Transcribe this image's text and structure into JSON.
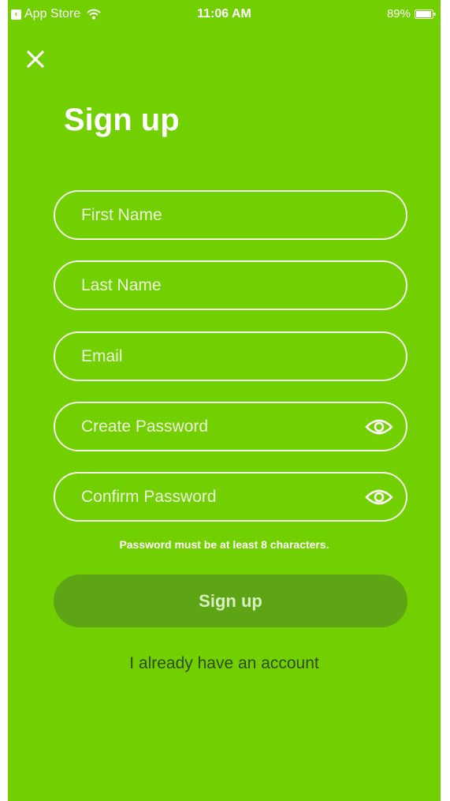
{
  "status_bar": {
    "back_app": "App Store",
    "time": "11:06 AM",
    "battery": "89%"
  },
  "title": "Sign up",
  "fields": {
    "first_name": "First Name",
    "last_name": "Last Name",
    "email": "Email",
    "create_password": "Create Password",
    "confirm_password": "Confirm Password"
  },
  "hint": "Password must be at least 8 characters.",
  "signup_button": "Sign up",
  "account_link": "I already have an account",
  "colors": {
    "background": "#72d000",
    "button": "#5ea515",
    "link": "#2e4d0f"
  }
}
